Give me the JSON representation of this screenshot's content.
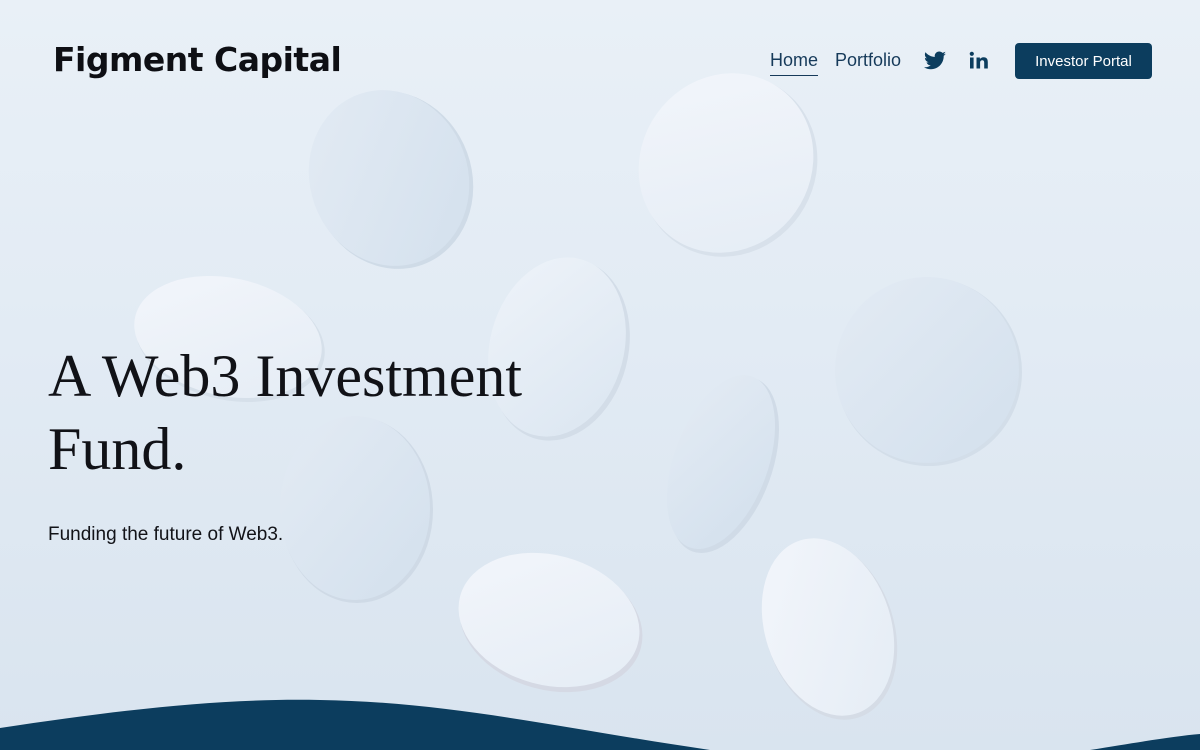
{
  "brand": {
    "logo_text": "Figment Capital"
  },
  "nav": {
    "items": [
      {
        "label": "Home",
        "active": true
      },
      {
        "label": "Portfolio",
        "active": false
      }
    ],
    "social": [
      {
        "icon": "twitter-icon"
      },
      {
        "icon": "linkedin-icon"
      }
    ],
    "cta_label": "Investor Portal"
  },
  "hero": {
    "title": "A Web3 Investment Fund.",
    "subtitle": "Funding the future of Web3."
  },
  "colors": {
    "brand_navy": "#0c3d5e",
    "nav_text": "#163a5a",
    "heading_text": "#111217",
    "background_light": "#e6eef6"
  }
}
